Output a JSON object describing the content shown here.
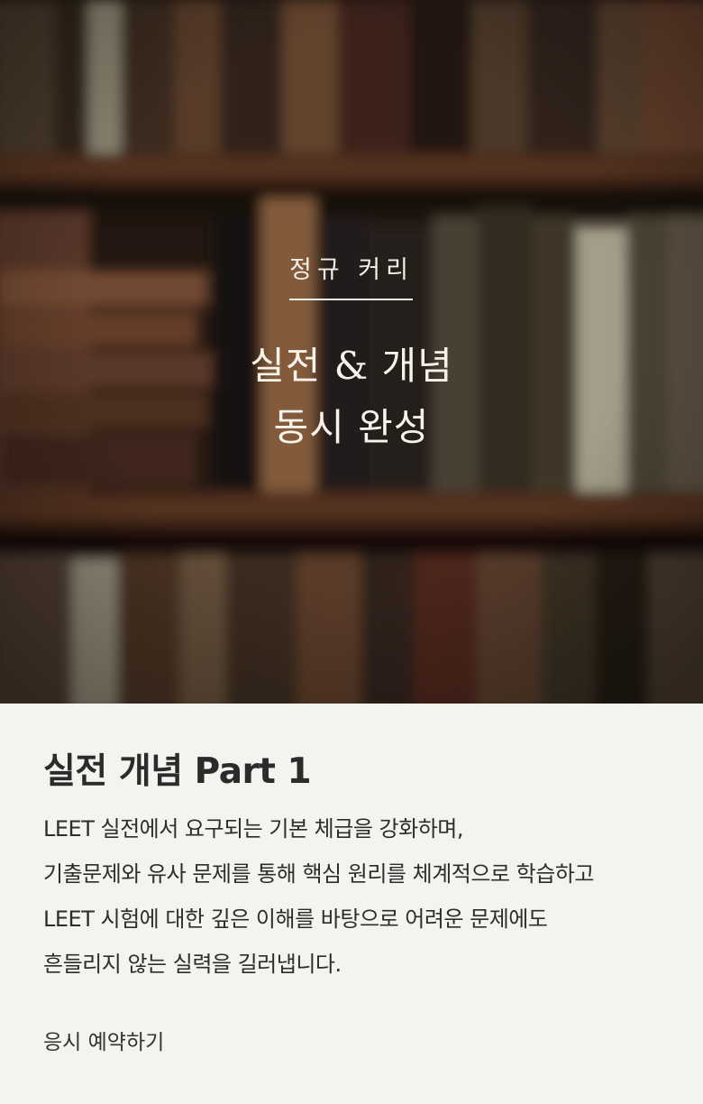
{
  "hero": {
    "eyebrow": "정규 커리",
    "title_line1": "실전 & 개념",
    "title_line2": "동시 완성"
  },
  "course": {
    "title": "실전 개념 Part 1",
    "description_lines": [
      "LEET 실전에서 요구되는 기본 체급을 강화하며,",
      "기출문제와 유사 문제를 통해 핵심 원리를 체계적으로 학습하고",
      "LEET 시험에 대한 깊은 이해를 바탕으로 어려운 문제에도",
      "흔들리지 않는 실력을 길러냅니다."
    ],
    "cta_label": "응시 예약하기"
  },
  "colors": {
    "panel_bg": "#f5f3ef",
    "hero_text": "#f4efe7",
    "body_text": "#2d2d2d"
  }
}
